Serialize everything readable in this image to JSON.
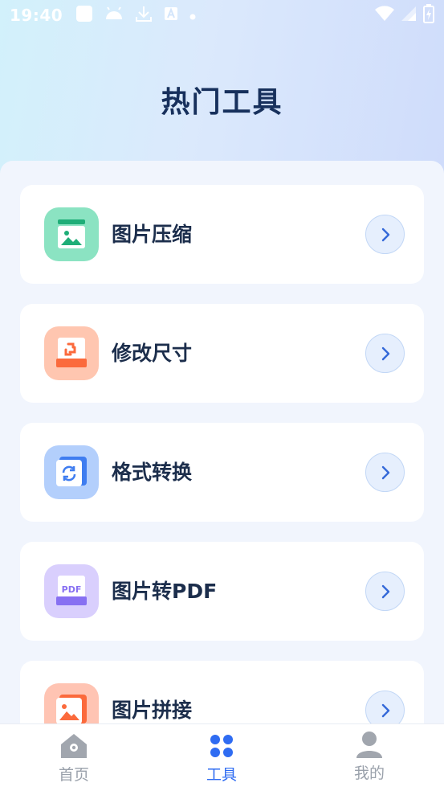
{
  "status_bar": {
    "time": "19:40",
    "left_icons": [
      "square-icon",
      "android-icon",
      "download-icon",
      "a-box-icon",
      "dot-icon"
    ],
    "right_icons": [
      "wifi-icon",
      "signal-icon",
      "battery-icon"
    ]
  },
  "header": {
    "title": "热门工具"
  },
  "tools": [
    {
      "label": "图片压缩",
      "icon": "image-compress-icon",
      "tile_color": "#8be3c2",
      "accent": "#1fae78"
    },
    {
      "label": "修改尺寸",
      "icon": "resize-icon",
      "tile_color": "#ffc6b0",
      "accent": "#fb6a3c"
    },
    {
      "label": "格式转换",
      "icon": "format-convert-icon",
      "tile_color": "#b3cffc",
      "accent": "#3f7df0"
    },
    {
      "label": "图片转PDF",
      "icon": "pdf-icon",
      "tile_color": "#d9cffd",
      "accent": "#8770f2",
      "badge": "PDF"
    },
    {
      "label": "图片拼接",
      "icon": "image-stitch-icon",
      "tile_color": "#ffc4b3",
      "accent": "#fb6a3c"
    }
  ],
  "nav": {
    "items": [
      {
        "label": "首页",
        "icon": "home-icon",
        "active": false
      },
      {
        "label": "工具",
        "icon": "grid-icon",
        "active": true
      },
      {
        "label": "我的",
        "icon": "user-icon",
        "active": false
      }
    ],
    "active_color": "#2f6cf2",
    "inactive_color": "#9aa1ab"
  }
}
